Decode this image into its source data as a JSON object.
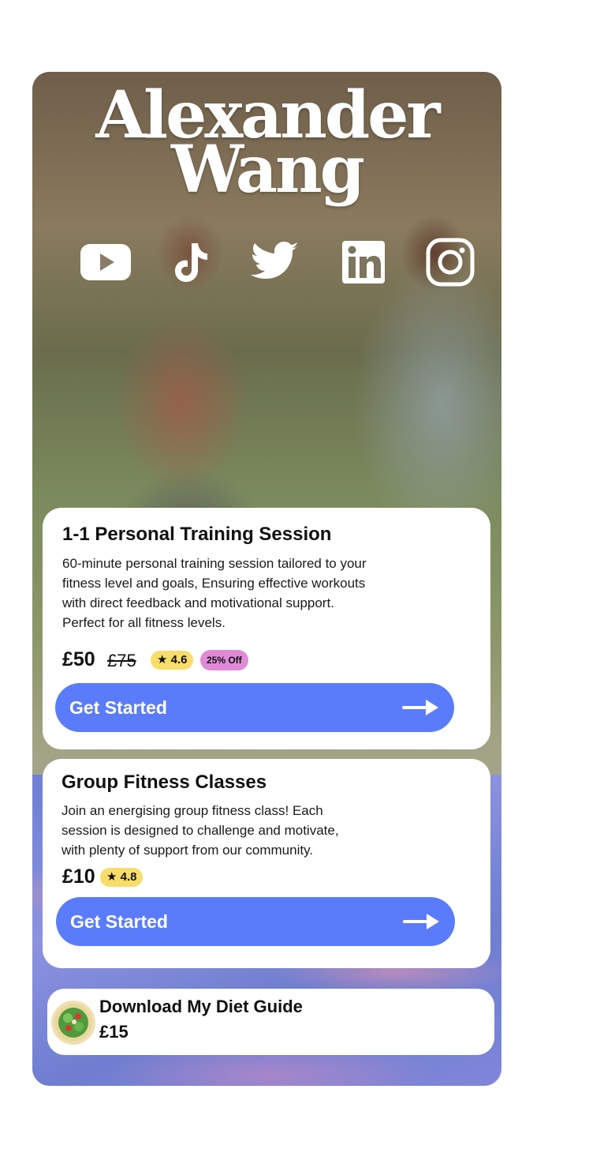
{
  "brand": {
    "line1": "Alexander",
    "line2": "Wang"
  },
  "socials": [
    {
      "name": "youtube",
      "icon": "youtube-icon"
    },
    {
      "name": "tiktok",
      "icon": "tiktok-icon"
    },
    {
      "name": "twitter",
      "icon": "twitter-icon"
    },
    {
      "name": "linkedin",
      "icon": "linkedin-icon"
    },
    {
      "name": "instagram",
      "icon": "instagram-icon"
    }
  ],
  "services": [
    {
      "title": "1-1 Personal Training Session",
      "description": [
        "60-minute personal training session tailored to your",
        "fitness level and goals, Ensuring effective workouts",
        "with direct feedback and motivational support.",
        "Perfect for all fitness levels."
      ],
      "price": "£50",
      "old_price": "£75",
      "rating": "★ 4.6",
      "discount": "25% Off",
      "cta": "Get Started"
    },
    {
      "title": "Group Fitness Classes",
      "description": [
        "Join an energising group fitness class! Each",
        "session is designed to challenge and motivate,",
        "with plenty of support from our community."
      ],
      "price": "£10",
      "rating": "★ 4.8",
      "cta": "Get Started"
    }
  ],
  "diet_guide": {
    "title": "Download My Diet Guide",
    "price": "£15"
  },
  "colors": {
    "cta": "#5b7cfa",
    "rating_badge": "#f9dd6a",
    "discount_badge": "#e08ad7",
    "card": "#ffffff"
  }
}
